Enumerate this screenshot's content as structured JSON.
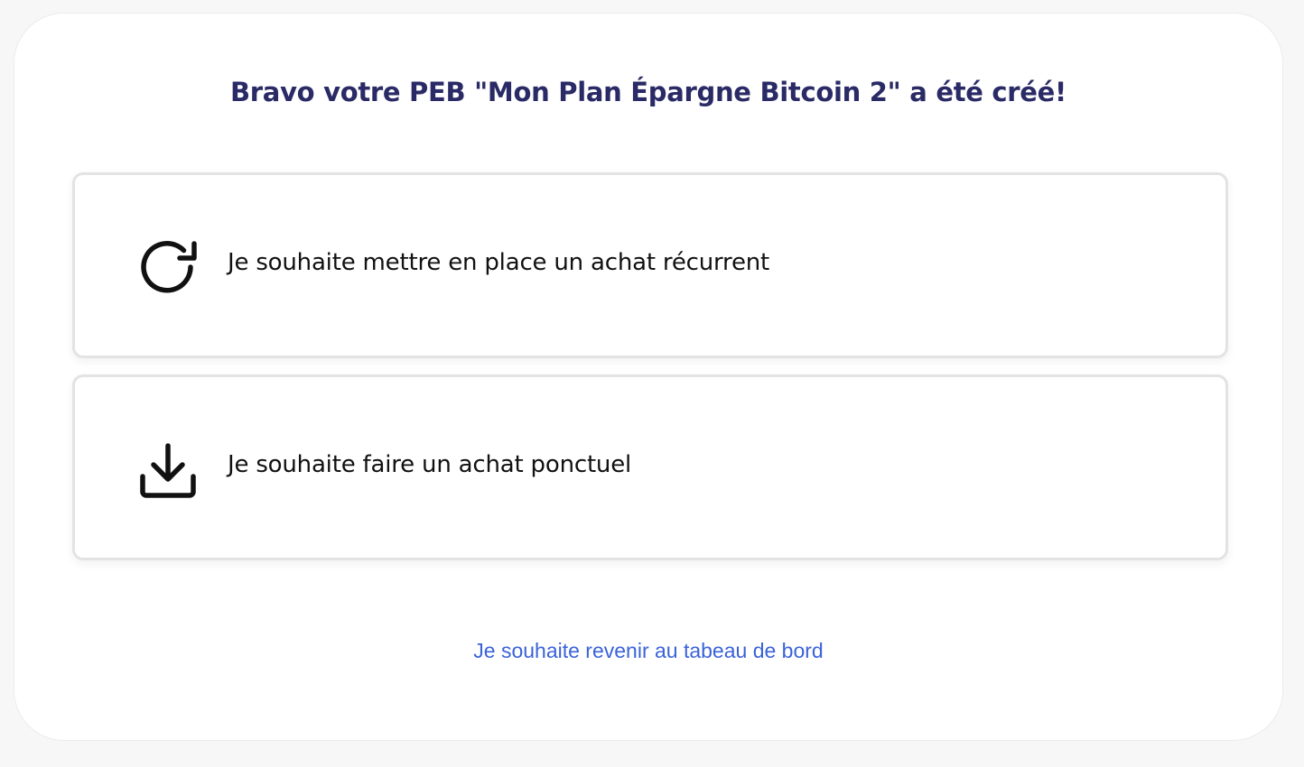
{
  "page": {
    "title": "Bravo votre PEB \"Mon Plan Épargne Bitcoin 2\" a été créé!"
  },
  "options": [
    {
      "label": "Je souhaite mettre en place un achat récurrent",
      "icon": "refresh-icon"
    },
    {
      "label": "Je souhaite faire un achat ponctuel",
      "icon": "download-icon"
    }
  ],
  "footer": {
    "back_link": "Je souhaite revenir au tabeau de bord"
  },
  "colors": {
    "title": "#2a2a66",
    "link": "#3b63d9",
    "card_border": "#e3e3e3",
    "background": "#f7f7f7"
  }
}
